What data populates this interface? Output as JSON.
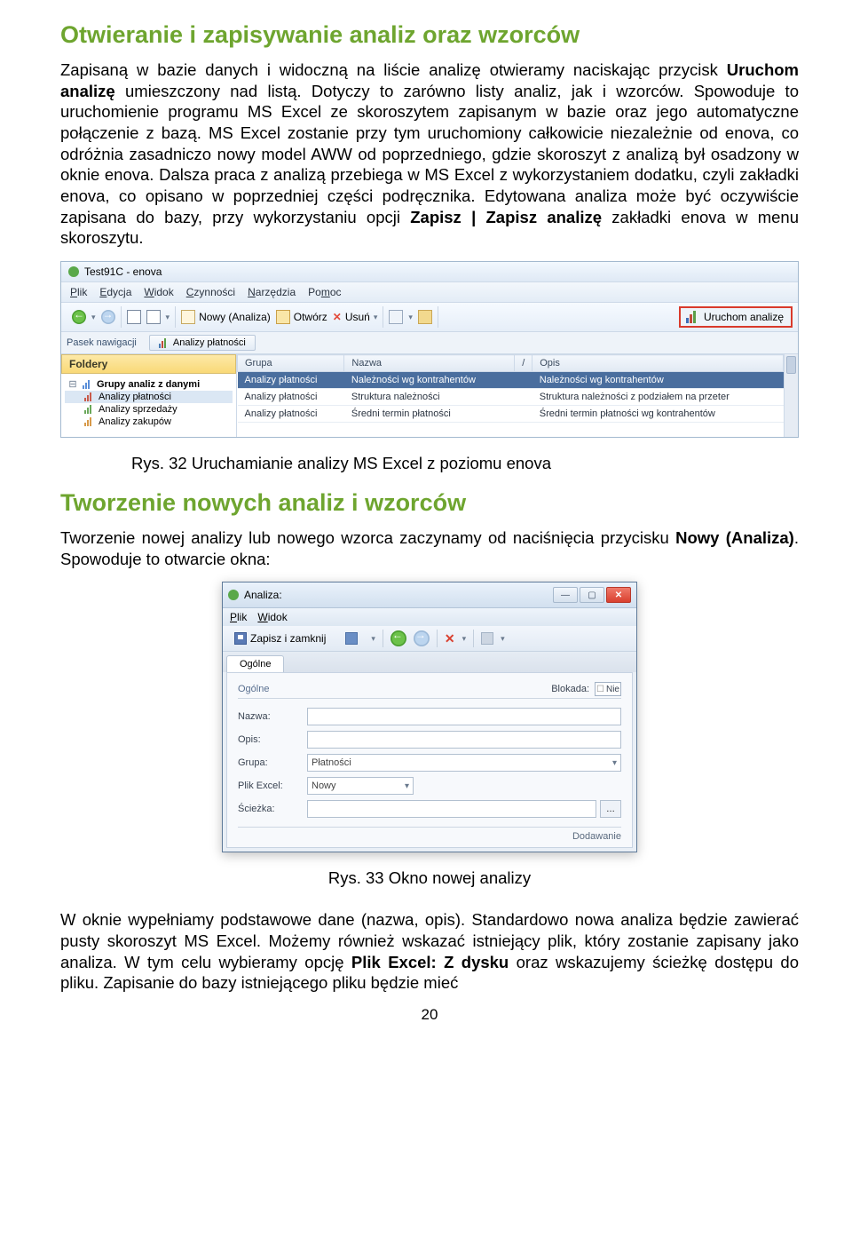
{
  "heading1": "Otwieranie i zapisywanie analiz oraz wzorców",
  "para1_a": "Zapisaną w bazie danych i widoczną na liście analizę otwieramy naciskając przycisk ",
  "para1_b_bold": "Uruchom analizę",
  "para1_c": " umieszczony nad listą. Dotyczy to zarówno listy analiz, jak i wzorców. Spowoduje to uruchomienie programu MS Excel ze skoroszytem zapisanym w bazie oraz jego automatyczne połączenie z bazą. MS Excel zostanie przy tym uruchomiony całkowicie niezależnie od enova, co odróżnia zasadniczo nowy model AWW od poprzedniego, gdzie skoroszyt z analizą był osadzony w oknie enova. Dalsza praca z analizą przebiega w MS Excel z wykorzystaniem dodatku, czyli zakładki enova, co opisano w poprzedniej części podręcznika. Edytowana analiza może być oczywiście zapisana do bazy, przy wykorzystaniu opcji ",
  "para1_d_bold": "Zapisz | Zapisz analizę",
  "para1_e": " zakładki enova w menu skoroszytu.",
  "screenshot1": {
    "title": "Test91C - enova",
    "menu": [
      "Plik",
      "Edycja",
      "Widok",
      "Czynności",
      "Narzędzia",
      "Pomoc"
    ],
    "toolbar": {
      "nowy": "Nowy (Analiza)",
      "otworz": "Otwórz",
      "usun": "Usuń",
      "uruchom": "Uruchom analizę"
    },
    "nav_label": "Pasek nawigacji",
    "crumb": "Analizy płatności",
    "folders_header": "Foldery",
    "tree": {
      "root": "Grupy analiz z danymi",
      "items": [
        "Analizy płatności",
        "Analizy sprzedaży",
        "Analizy zakupów"
      ]
    },
    "grid": {
      "headers": [
        "Grupa",
        "Nazwa",
        "",
        "Opis"
      ],
      "rows": [
        [
          "Analizy płatności",
          "Należności wg kontrahentów",
          "",
          "Należności wg kontrahentów"
        ],
        [
          "Analizy płatności",
          "Struktura należności",
          "",
          "Struktura należności z podziałem na przeter"
        ],
        [
          "Analizy płatności",
          "Średni termin płatności",
          "",
          "Średni termin płatności wg kontrahentów"
        ]
      ]
    }
  },
  "caption1": "Rys. 32 Uruchamianie analizy MS Excel z poziomu enova",
  "heading2": "Tworzenie nowych analiz i wzorców",
  "para2_a": "Tworzenie nowej analizy lub nowego wzorca zaczynamy od naciśnięcia przycisku ",
  "para2_b_bold": "Nowy (Analiza)",
  "para2_c": ". Spowoduje to otwarcie okna:",
  "screenshot2": {
    "title": "Analiza:",
    "menu": [
      "Plik",
      "Widok"
    ],
    "toolbar": {
      "save_close": "Zapisz i zamknij"
    },
    "tab": "Ogólne",
    "section": "Ogólne",
    "blokada_label": "Blokada:",
    "blokada_value": "Nie",
    "fields": {
      "nazwa": "Nazwa:",
      "opis": "Opis:",
      "grupa": "Grupa:",
      "grupa_value": "Płatności",
      "plik": "Plik Excel:",
      "plik_value": "Nowy",
      "sciezka": "Ścieżka:"
    },
    "footer": "Dodawanie"
  },
  "caption2": "Rys. 33 Okno nowej analizy",
  "para3_a": "W oknie wypełniamy podstawowe dane (nazwa, opis). Standardowo nowa analiza będzie zawierać pusty skoroszyt MS Excel. Możemy również wskazać istniejący plik, który zostanie zapisany jako analiza. W tym celu wybieramy opcję ",
  "para3_b_bold": "Plik Excel: Z dysku",
  "para3_c": " oraz wskazujemy ścieżkę dostępu do pliku. Zapisanie do bazy istniejącego pliku będzie mieć",
  "page_number": "20"
}
